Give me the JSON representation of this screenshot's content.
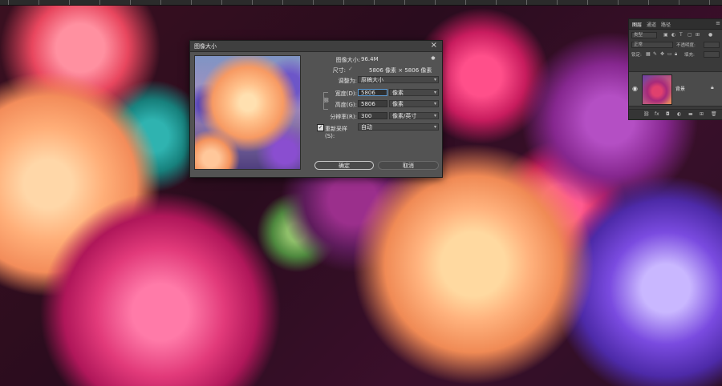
{
  "dialog": {
    "title": "图像大小",
    "close_label": "×",
    "image_size_label": "图像大小:",
    "image_size_value": "96.4M",
    "dimensions_label": "尺寸:",
    "dimensions_value": "5806 像素 × 5806 像素",
    "fit_to_label": "调整为:",
    "fit_to_value": "原稿大小",
    "width_label": "宽度(D):",
    "width_value": "5806",
    "width_unit": "像素",
    "height_label": "高度(G):",
    "height_value": "5806",
    "height_unit": "像素",
    "resolution_label": "分辨率(R):",
    "resolution_value": "300",
    "resolution_unit": "像素/英寸",
    "resample_label": "重新采样(S):",
    "resample_checked": true,
    "resample_value": "自动",
    "ok_label": "确定",
    "cancel_label": "取消"
  },
  "layers_panel": {
    "tabs": [
      "图层",
      "通道",
      "路径"
    ],
    "kind_placeholder": "类型",
    "blend_mode": "正常",
    "opacity_label": "不透明度:",
    "lock_label": "锁定:",
    "fill_label": "填充:",
    "layer_name": "背景"
  },
  "icons": {
    "close": "close-icon",
    "gear": "gear-icon",
    "link": "chain-link-icon",
    "eye": "eye-icon",
    "lock": "lock-icon",
    "panel_menu": "panel-menu-icon"
  },
  "colors": {
    "dialog_bg": "#535353",
    "panel_bg": "#3a3a3a",
    "focus": "#5b9bd5"
  }
}
